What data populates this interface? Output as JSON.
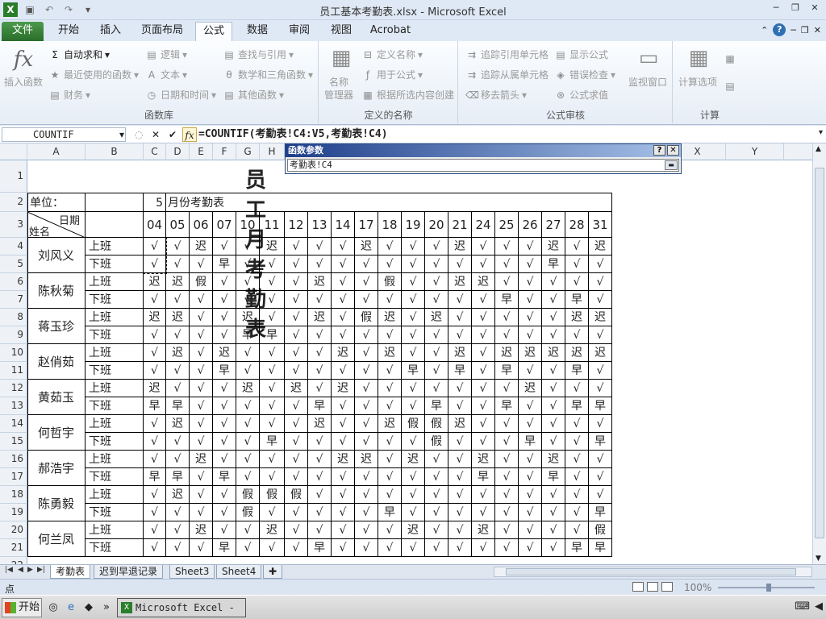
{
  "window": {
    "title": "员工基本考勤表.xlsx - Microsoft Excel",
    "minimize": "─",
    "restore": "❐",
    "close": "✕"
  },
  "tabs": [
    "文件",
    "开始",
    "插入",
    "页面布局",
    "公式",
    "数据",
    "审阅",
    "视图",
    "Acrobat"
  ],
  "ribbon": {
    "insert_function": "插入函数",
    "autosum": "自动求和",
    "recent": "最近使用的函数",
    "financial": "财务",
    "logical": "逻辑",
    "text": "文本",
    "datetime": "日期和时间",
    "lookup": "查找与引用",
    "math": "数学和三角函数",
    "other": "其他函数",
    "group_library": "函数库",
    "name_manager_1": "名称",
    "name_manager_2": "管理器",
    "define_name": "定义名称",
    "use_in_formula": "用于公式",
    "create_from_sel": "根据所选内容创建",
    "group_names": "定义的名称",
    "trace_prec": "追踪引用单元格",
    "trace_dep": "追踪从属单元格",
    "remove_arrows": "移去箭头",
    "show_formulas": "显示公式",
    "error_check": "错误检查",
    "evaluate": "公式求值",
    "watch": "监视窗口",
    "group_audit": "公式审核",
    "calc_options": "计算选项",
    "group_calc": "计算"
  },
  "formula_bar": {
    "name_box": "COUNTIF",
    "formula": "=COUNTIF(考勤表!C4:V5,考勤表!C4)"
  },
  "dialog": {
    "title": "函数参数",
    "input": "考勤表!C4",
    "help": "?",
    "close": "✕"
  },
  "columns": [
    "A",
    "B",
    "C",
    "D",
    "E",
    "F",
    "G",
    "H",
    "X",
    "Y"
  ],
  "row_numbers": [
    "1",
    "2",
    "3",
    "4",
    "5",
    "6",
    "7",
    "8",
    "9",
    "10",
    "11",
    "12",
    "13",
    "14",
    "15",
    "16",
    "17",
    "18",
    "19",
    "20",
    "21",
    "22"
  ],
  "sheet": {
    "title": "员工月考勤表",
    "unit_label": "单位：",
    "month": "5",
    "month_label": "月份考勤表",
    "corner_date": "日期",
    "corner_name": "姓名",
    "dates": [
      "04",
      "05",
      "06",
      "07",
      "10",
      "11",
      "12",
      "13",
      "14",
      "17",
      "18",
      "19",
      "20",
      "21",
      "24",
      "25",
      "26",
      "27",
      "28",
      "31"
    ],
    "shift_on": "上班",
    "shift_off": "下班",
    "employees": [
      {
        "name": "刘风义",
        "on": [
          "√",
          "√",
          "迟",
          "√",
          "√",
          "迟",
          "√",
          "√",
          "√",
          "迟",
          "√",
          "√",
          "√",
          "迟",
          "√",
          "√",
          "√",
          "迟",
          "√",
          "迟"
        ],
        "off": [
          "√",
          "√",
          "√",
          "早",
          "√",
          "√",
          "√",
          "√",
          "√",
          "√",
          "√",
          "√",
          "√",
          "√",
          "√",
          "√",
          "√",
          "早",
          "√",
          "√"
        ]
      },
      {
        "name": "陈秋菊",
        "on": [
          "迟",
          "迟",
          "假",
          "√",
          "√",
          "√",
          "√",
          "迟",
          "√",
          "√",
          "假",
          "√",
          "√",
          "迟",
          "迟",
          "√",
          "√",
          "√",
          "√",
          "√"
        ],
        "off": [
          "√",
          "√",
          "√",
          "√",
          "√",
          "√",
          "√",
          "√",
          "√",
          "√",
          "√",
          "√",
          "√",
          "√",
          "√",
          "早",
          "√",
          "√",
          "早",
          "√"
        ]
      },
      {
        "name": "蒋玉珍",
        "on": [
          "迟",
          "迟",
          "√",
          "√",
          "迟",
          "√",
          "√",
          "迟",
          "√",
          "假",
          "迟",
          "√",
          "迟",
          "√",
          "√",
          "√",
          "√",
          "√",
          "迟",
          "迟"
        ],
        "off": [
          "√",
          "√",
          "√",
          "√",
          "早",
          "早",
          "√",
          "√",
          "√",
          "√",
          "√",
          "√",
          "√",
          "√",
          "√",
          "√",
          "√",
          "√",
          "√",
          "√"
        ]
      },
      {
        "name": "赵俏茹",
        "on": [
          "√",
          "迟",
          "√",
          "迟",
          "√",
          "√",
          "√",
          "√",
          "迟",
          "√",
          "迟",
          "√",
          "√",
          "迟",
          "√",
          "迟",
          "迟",
          "迟",
          "迟",
          "迟"
        ],
        "off": [
          "√",
          "√",
          "√",
          "早",
          "√",
          "√",
          "√",
          "√",
          "√",
          "√",
          "√",
          "早",
          "√",
          "早",
          "√",
          "早",
          "√",
          "√",
          "早",
          "√"
        ]
      },
      {
        "name": "黄茹玉",
        "on": [
          "迟",
          "√",
          "√",
          "√",
          "迟",
          "√",
          "迟",
          "√",
          "迟",
          "√",
          "√",
          "√",
          "√",
          "√",
          "√",
          "√",
          "迟",
          "√",
          "√",
          "√"
        ],
        "off": [
          "早",
          "早",
          "√",
          "√",
          "√",
          "√",
          "√",
          "早",
          "√",
          "√",
          "√",
          "√",
          "早",
          "√",
          "√",
          "早",
          "√",
          "√",
          "早",
          "早"
        ]
      },
      {
        "name": "何哲宇",
        "on": [
          "√",
          "迟",
          "√",
          "√",
          "√",
          "√",
          "√",
          "迟",
          "√",
          "√",
          "迟",
          "假",
          "假",
          "迟",
          "√",
          "√",
          "√",
          "√",
          "√",
          "√"
        ],
        "off": [
          "√",
          "√",
          "√",
          "√",
          "√",
          "早",
          "√",
          "√",
          "√",
          "√",
          "√",
          "√",
          "假",
          "√",
          "√",
          "√",
          "早",
          "√",
          "√",
          "早"
        ]
      },
      {
        "name": "郝浩宇",
        "on": [
          "√",
          "√",
          "迟",
          "√",
          "√",
          "√",
          "√",
          "√",
          "迟",
          "迟",
          "√",
          "迟",
          "√",
          "√",
          "迟",
          "√",
          "√",
          "迟",
          "√",
          "√"
        ],
        "off": [
          "早",
          "早",
          "√",
          "早",
          "√",
          "√",
          "√",
          "√",
          "√",
          "√",
          "√",
          "√",
          "√",
          "√",
          "早",
          "√",
          "√",
          "早",
          "√",
          "√"
        ]
      },
      {
        "name": "陈勇毅",
        "on": [
          "√",
          "迟",
          "√",
          "√",
          "假",
          "假",
          "假",
          "√",
          "√",
          "√",
          "√",
          "√",
          "√",
          "√",
          "√",
          "√",
          "√",
          "√",
          "√",
          "√"
        ],
        "off": [
          "√",
          "√",
          "√",
          "√",
          "假",
          "√",
          "√",
          "√",
          "√",
          "√",
          "早",
          "√",
          "√",
          "√",
          "√",
          "√",
          "√",
          "√",
          "√",
          "早"
        ]
      },
      {
        "name": "何兰凤",
        "on": [
          "√",
          "√",
          "迟",
          "√",
          "√",
          "迟",
          "√",
          "√",
          "√",
          "√",
          "√",
          "迟",
          "√",
          "√",
          "迟",
          "√",
          "√",
          "√",
          "√",
          "假"
        ],
        "off": [
          "√",
          "√",
          "√",
          "早",
          "√",
          "√",
          "√",
          "早",
          "√",
          "√",
          "√",
          "√",
          "√",
          "√",
          "√",
          "√",
          "√",
          "√",
          "早",
          "早"
        ]
      }
    ]
  },
  "sheet_tabs": [
    "考勤表",
    "迟到早退记录",
    "Sheet3",
    "Sheet4"
  ],
  "status": {
    "mode": "点",
    "zoom": "100%"
  },
  "taskbar": {
    "start": "开始",
    "task": "Microsoft Excel - ..."
  }
}
